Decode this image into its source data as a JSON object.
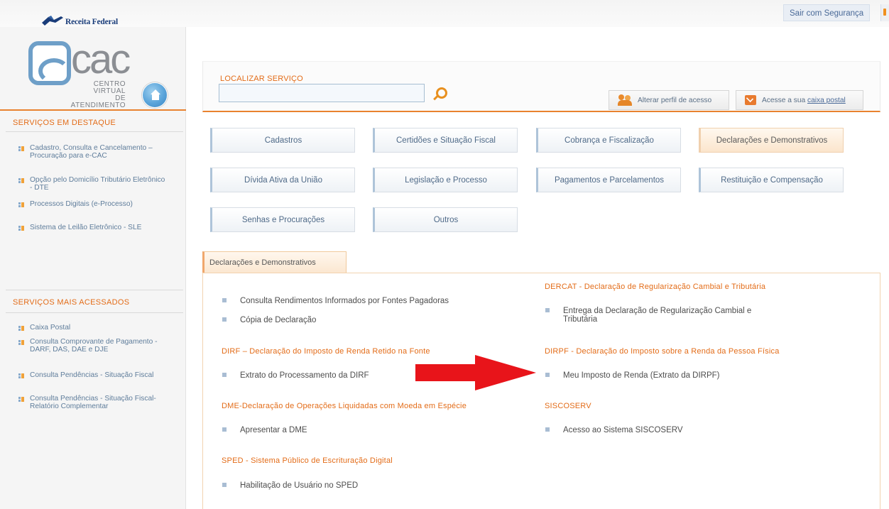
{
  "header": {
    "brand": "Receita Federal",
    "logout_label": "Sair com Segurança"
  },
  "logo": {
    "main": "cac",
    "sub_line1": "CENTRO VIRTUAL",
    "sub_line2": "DE ATENDIMENTO"
  },
  "search": {
    "label": "LOCALIZAR SERVIÇO",
    "value": "",
    "placeholder": ""
  },
  "actions": {
    "profile": "Alterar perfil de acesso",
    "postal_prefix": "Acesse a sua ",
    "postal_link": "caixa postal"
  },
  "sidebar": {
    "featured_title": "SERVIÇOS EM DESTAQUE",
    "featured": [
      "Cadastro, Consulta e Cancelamento – Procuração para e-CAC",
      "Opção pelo Domicílio Tributário Eletrônico - DTE",
      "Processos Digitais (e-Processo)",
      "Sistema de Leilão Eletrônico - SLE"
    ],
    "most_title": "SERVIÇOS MAIS ACESSADOS",
    "most": [
      "Caixa Postal",
      "Consulta Comprovante de Pagamento - DARF, DAS, DAE e DJE",
      "Consulta Pendências - Situação Fiscal",
      "Consulta Pendências - Situação Fiscal-Relatório Complementar"
    ]
  },
  "categories": [
    "Cadastros",
    "Certidões e Situação Fiscal",
    "Cobrança e Fiscalização",
    "Declarações e Demonstrativos",
    "Dívida Ativa da União",
    "Legislação e Processo",
    "Pagamentos e Parcelamentos",
    "Restituição e Compensação",
    "Senhas e Procurações",
    "Outros"
  ],
  "active_tab": "Declarações e Demonstrativos",
  "groups": {
    "general_items": [
      "Consulta Rendimentos Informados por Fontes Pagadoras",
      "Cópia de Declaração"
    ],
    "dercat_title": "DERCAT - Declaração de Regularização Cambial e Tributária",
    "dercat_items": [
      "Entrega da Declaração de Regularização Cambial e Tributária"
    ],
    "dirf_title": "DIRF – Declaração do Imposto de Renda Retido na Fonte",
    "dirf_items": [
      "Extrato do Processamento da DIRF"
    ],
    "dirpf_title": "DIRPF - Declaração do Imposto sobre a Renda da Pessoa Física",
    "dirpf_items": [
      "Meu Imposto de Renda (Extrato da DIRPF)"
    ],
    "dme_title": "DME-Declaração de Operações Liquidadas com Moeda em Espécie",
    "dme_items": [
      "Apresentar a DME"
    ],
    "siscoserv_title": "SISCOSERV",
    "siscoserv_items": [
      "Acesso ao Sistema SISCOSERV"
    ],
    "sped_title": "SPED - Sistema Público de Escrituração Digital",
    "sped_items": [
      "Habilitação de Usuário no SPED"
    ]
  },
  "colors": {
    "accent": "#e36c18",
    "link": "#4f6a88",
    "arrow": "#e8141a"
  }
}
